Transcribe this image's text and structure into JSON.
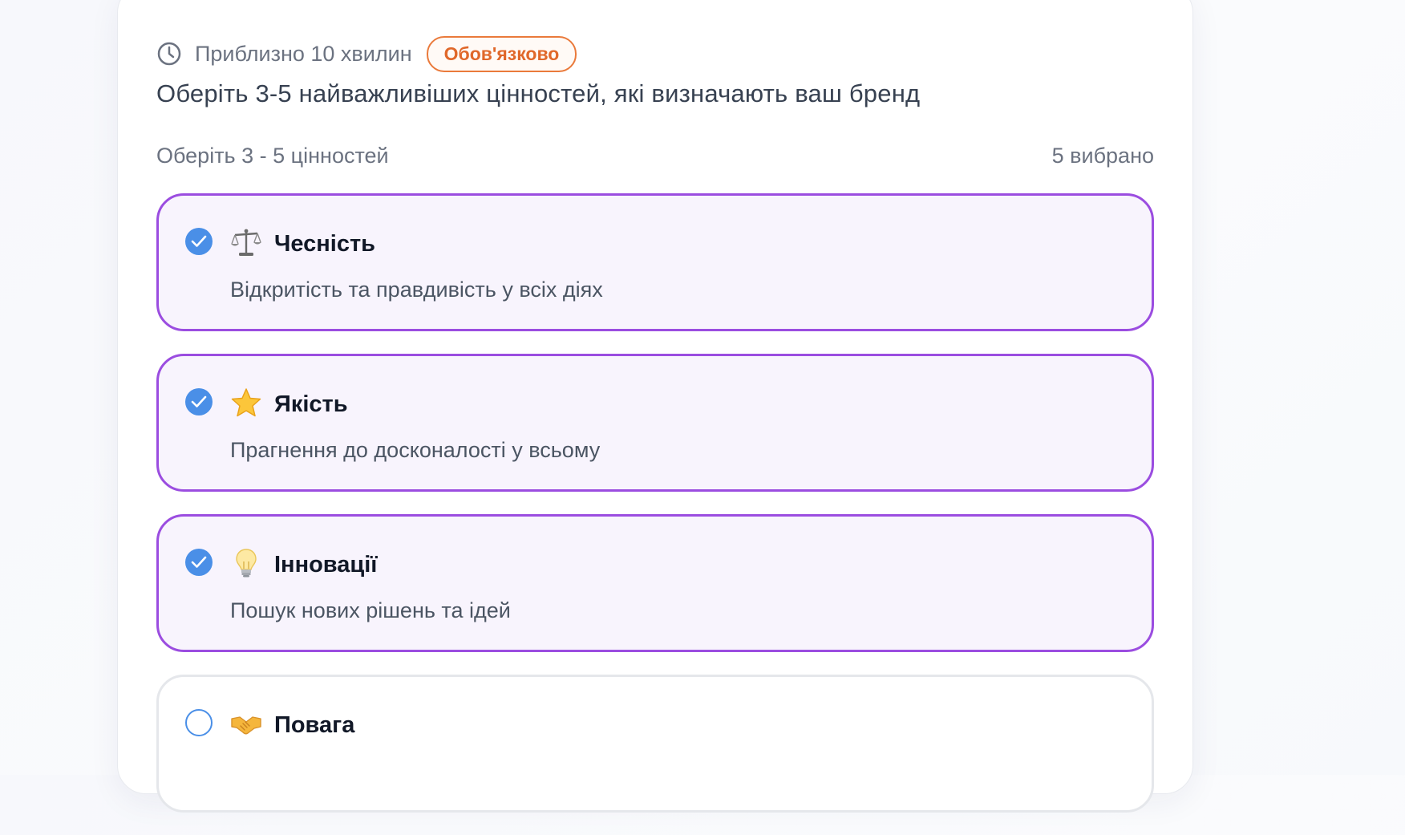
{
  "header": {
    "time_estimate": "Приблизно 10 хвилин",
    "required_badge": "Обов'язково"
  },
  "question": {
    "text": "Оберіть 3-5 найважливіших цінностей, які визначають ваш бренд",
    "hint": "Оберіть 3 - 5 цінностей",
    "selected_count": "5 вибрано"
  },
  "options": [
    {
      "icon": "scales-icon",
      "title": "Чесність",
      "description": "Відкритість та правдивість у всіх діях",
      "selected": true
    },
    {
      "icon": "star-icon",
      "title": "Якість",
      "description": "Прагнення до досконалості у всьому",
      "selected": true
    },
    {
      "icon": "lightbulb-icon",
      "title": "Інновації",
      "description": "Пошук нових рішень та ідей",
      "selected": true
    },
    {
      "icon": "handshake-icon",
      "title": "Повага",
      "description": "",
      "selected": false
    }
  ],
  "colors": {
    "accent_purple": "#9b4de0",
    "check_blue": "#4a8fe7",
    "badge_orange": "#e0682a"
  }
}
